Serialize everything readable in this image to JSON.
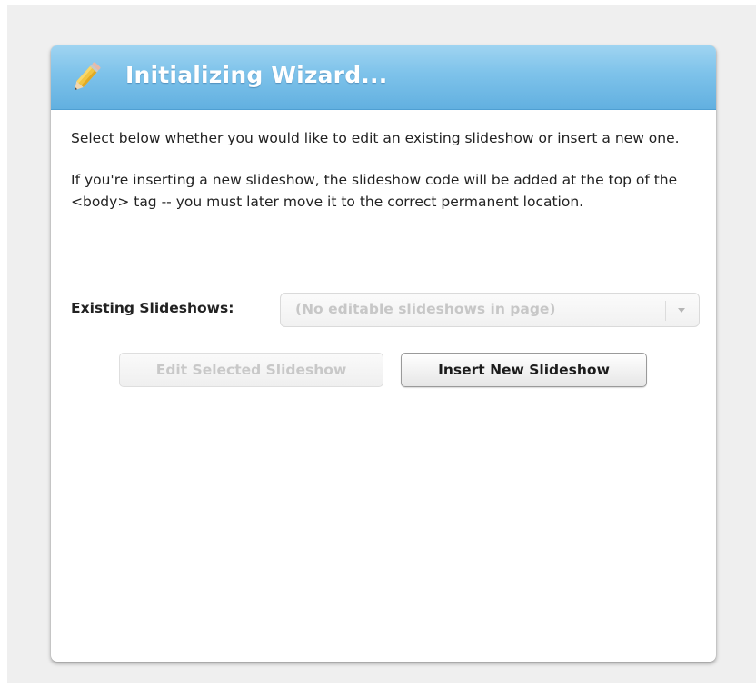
{
  "dialog": {
    "title": "Initializing Wizard...",
    "icon": "pencil-icon",
    "paragraph1": "Select below whether you would like to edit an existing slideshow or insert a new one.",
    "paragraph2": "If you're inserting a new slideshow, the slideshow code will be added at the top of the <body> tag -- you must later move it to the correct permanent location.",
    "existing_label": "Existing Slideshows:",
    "select": {
      "value": "(No editable slideshows in page)",
      "disabled": true
    },
    "buttons": {
      "edit_label": "Edit Selected Slideshow",
      "insert_label": "Insert New Slideshow"
    }
  },
  "colors": {
    "titlebar_top": "#9fd4f1",
    "titlebar_bottom": "#62b0e0",
    "title_text": "#ffffff",
    "disabled_text": "#c8c8c8",
    "body_text": "#222222"
  }
}
